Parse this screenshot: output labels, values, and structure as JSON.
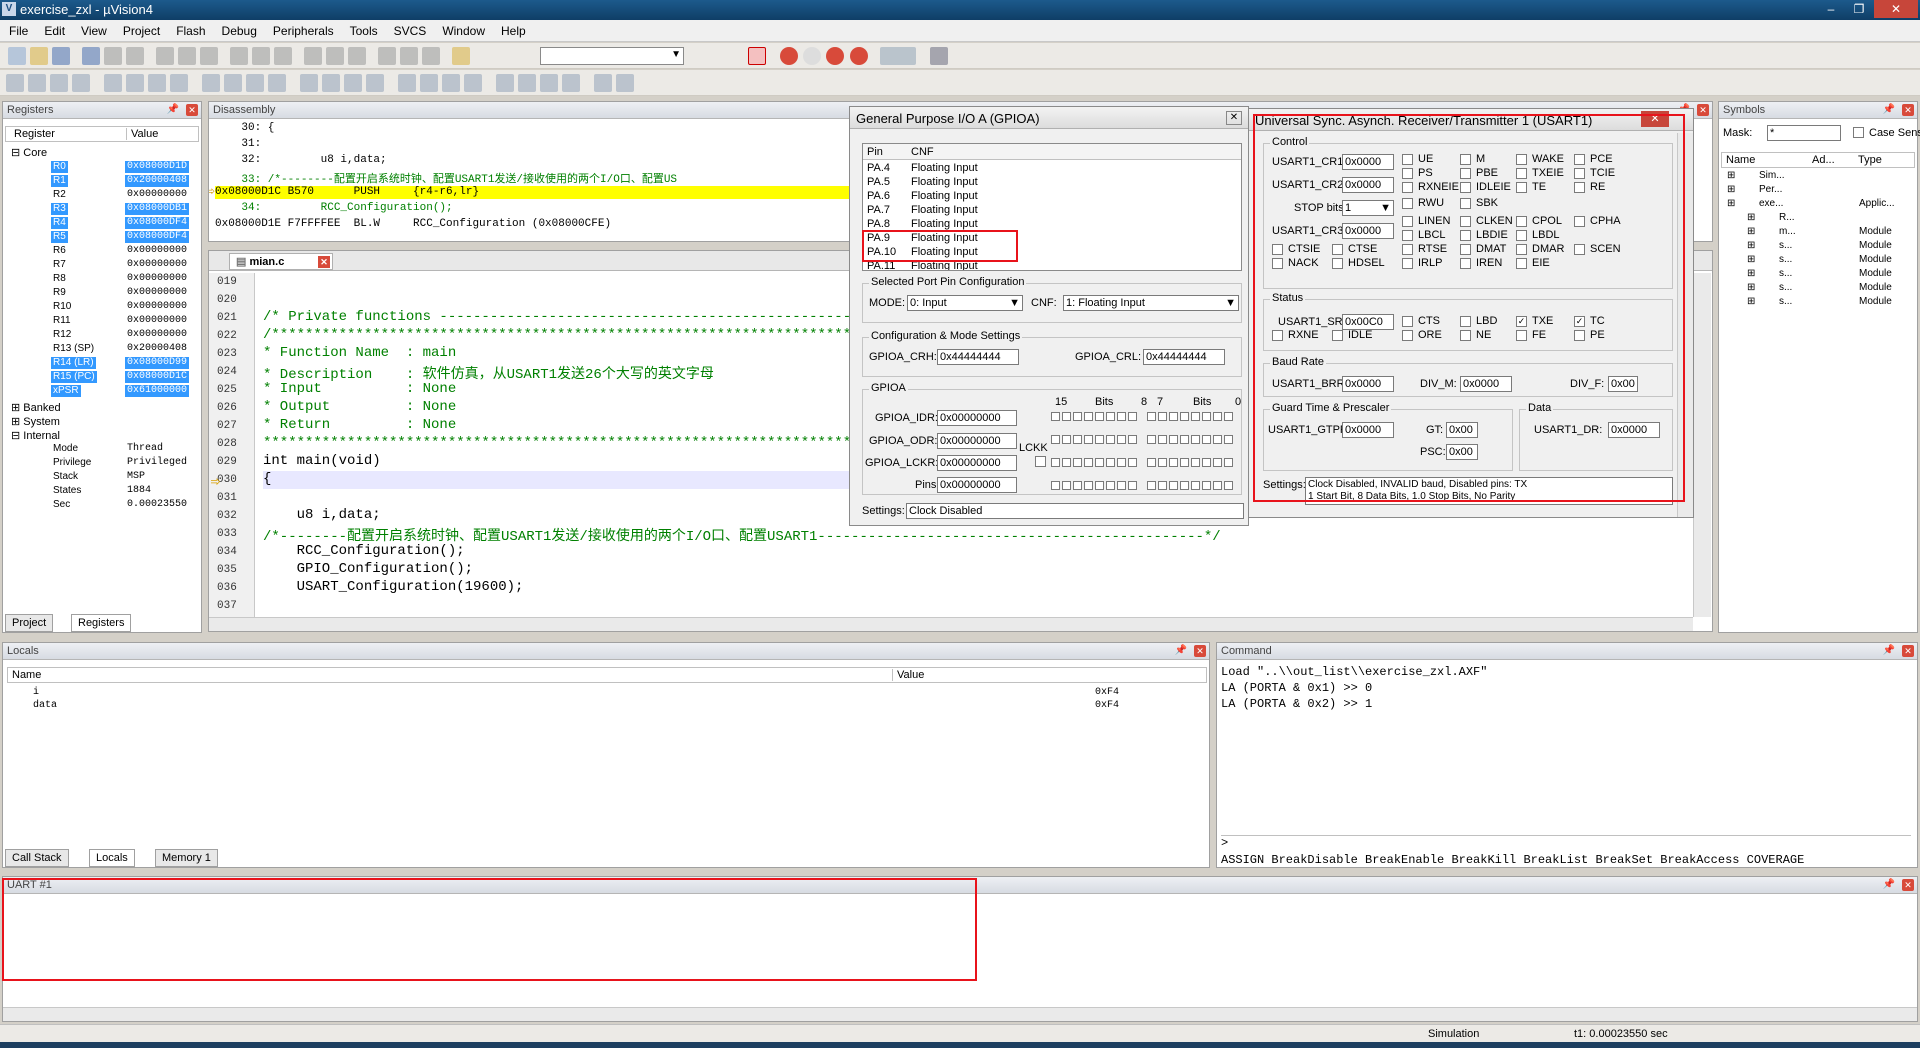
{
  "window": {
    "title": "exercise_zxl - µVision4"
  },
  "menu": [
    "File",
    "Edit",
    "View",
    "Project",
    "Flash",
    "Debug",
    "Peripherals",
    "Tools",
    "SVCS",
    "Window",
    "Help"
  ],
  "registers": {
    "title": "Registers",
    "col_register": "Register",
    "col_value": "Value",
    "core": "Core",
    "rows": [
      {
        "name": "R0",
        "value": "0x08000D1D",
        "sel": true
      },
      {
        "name": "R1",
        "value": "0x20000408",
        "sel": true
      },
      {
        "name": "R2",
        "value": "0x00000000",
        "sel": false
      },
      {
        "name": "R3",
        "value": "0x08000DB1",
        "sel": true
      },
      {
        "name": "R4",
        "value": "0x08000DF4",
        "sel": true
      },
      {
        "name": "R5",
        "value": "0x08000DF4",
        "sel": true
      },
      {
        "name": "R6",
        "value": "0x00000000",
        "sel": false
      },
      {
        "name": "R7",
        "value": "0x00000000",
        "sel": false
      },
      {
        "name": "R8",
        "value": "0x00000000",
        "sel": false
      },
      {
        "name": "R9",
        "value": "0x00000000",
        "sel": false
      },
      {
        "name": "R10",
        "value": "0x00000000",
        "sel": false
      },
      {
        "name": "R11",
        "value": "0x00000000",
        "sel": false
      },
      {
        "name": "R12",
        "value": "0x00000000",
        "sel": false
      },
      {
        "name": "R13 (SP)",
        "value": "0x20000408",
        "sel": false
      },
      {
        "name": "R14 (LR)",
        "value": "0x08000D99",
        "sel": true
      },
      {
        "name": "R15 (PC)",
        "value": "0x08000D1C",
        "sel": true
      },
      {
        "name": "xPSR",
        "value": "0x61000000",
        "sel": true
      }
    ],
    "banked": "Banked",
    "system": "System",
    "internal": "Internal",
    "internal_rows": [
      {
        "name": "Mode",
        "value": "Thread"
      },
      {
        "name": "Privilege",
        "value": "Privileged"
      },
      {
        "name": "Stack",
        "value": "MSP"
      },
      {
        "name": "States",
        "value": "1884"
      },
      {
        "name": "Sec",
        "value": "0.00023550"
      }
    ],
    "tab_project": "Project",
    "tab_registers": "Registers"
  },
  "disassembly": {
    "title": "Disassembly",
    "lines": [
      "    30: {",
      "    31:",
      "    32:         u8 i,data;",
      "    33: /*--------配置开启系统时钟、配置USART1发送/接收使用的两个I/O口、配置US",
      "0x08000D1C B570      PUSH     {r4-r6,lr}",
      "    34:         RCC_Configuration();",
      "0x08000D1E F7FFFFEE  BL.W     RCC_Configuration (0x08000CFE)"
    ]
  },
  "editor": {
    "tab": "mian.c",
    "lines": [
      {
        "n": "019",
        "t": "",
        "c": ""
      },
      {
        "n": "020",
        "t": "",
        "c": ""
      },
      {
        "n": "021",
        "t": "/* Private functions ------------------------------------------------------",
        "c": "green"
      },
      {
        "n": "022",
        "t": "/*******************************************************************************",
        "c": "green"
      },
      {
        "n": "023",
        "t": "* Function Name  : main",
        "c": "green"
      },
      {
        "n": "024",
        "t": "* Description    : 软件仿真，从USART1发送26个大写的英文字母",
        "c": "green"
      },
      {
        "n": "025",
        "t": "* Input          : None",
        "c": "green"
      },
      {
        "n": "026",
        "t": "* Output         : None",
        "c": "green"
      },
      {
        "n": "027",
        "t": "* Return         : None",
        "c": "green"
      },
      {
        "n": "028",
        "t": "*******************************************************************************",
        "c": "green"
      },
      {
        "n": "029",
        "t": "int main(void)",
        "c": ""
      },
      {
        "n": "030",
        "t": "{",
        "c": ""
      },
      {
        "n": "031",
        "t": "",
        "c": ""
      },
      {
        "n": "032",
        "t": "    u8 i,data;",
        "c": ""
      },
      {
        "n": "033",
        "t": "/*--------配置开启系统时钟、配置USART1发送/接收使用的两个I/O口、配置USART1----------------------------------------------*/",
        "c": "green"
      },
      {
        "n": "034",
        "t": "    RCC_Configuration();",
        "c": ""
      },
      {
        "n": "035",
        "t": "    GPIO_Configuration();",
        "c": ""
      },
      {
        "n": "036",
        "t": "    USART_Configuration(19600);",
        "c": ""
      },
      {
        "n": "037",
        "t": "",
        "c": ""
      }
    ]
  },
  "gpio": {
    "title": "General Purpose I/O A (GPIOA)",
    "col_pin": "Pin",
    "col_cnf": "CNF",
    "pins": [
      {
        "pin": "PA.4",
        "cnf": "Floating Input"
      },
      {
        "pin": "PA.5",
        "cnf": "Floating Input"
      },
      {
        "pin": "PA.6",
        "cnf": "Floating Input"
      },
      {
        "pin": "PA.7",
        "cnf": "Floating Input"
      },
      {
        "pin": "PA.8",
        "cnf": "Floating Input"
      },
      {
        "pin": "PA.9",
        "cnf": "Floating Input"
      },
      {
        "pin": "PA.10",
        "cnf": "Floating Input"
      },
      {
        "pin": "PA.11",
        "cnf": "Floating Input"
      }
    ],
    "selected_title": "Selected Port Pin Configuration",
    "mode_label": "MODE:",
    "mode_value": "0: Input",
    "cnf_label": "CNF:",
    "cnf_value": "1: Floating Input",
    "cfg_title": "Configuration & Mode Settings",
    "crh_label": "GPIOA_CRH:",
    "crh_value": "0x44444444",
    "crl_label": "GPIOA_CRL:",
    "crl_value": "0x44444444",
    "gpioa_title": "GPIOA",
    "bits15": "15",
    "bits_label": "Bits",
    "bits8": "8",
    "bits7": "7",
    "bits0": "0",
    "idr_label": "GPIOA_IDR:",
    "idr_value": "0x00000000",
    "odr_label": "GPIOA_ODR:",
    "odr_value": "0x00000000",
    "lckk": "LCKK",
    "lckr_label": "GPIOA_LCKR:",
    "lckr_value": "0x00000000",
    "pins_label": "Pins:",
    "pins_value": "0x00000000",
    "settings_label": "Settings:",
    "settings_value": "Clock Disabled"
  },
  "usart": {
    "title": "Universal Sync. Asynch. Receiver/Transmitter 1 (USART1)",
    "control": "Control",
    "cr1_label": "USART1_CR1:",
    "cr1_value": "0x0000",
    "cr2_label": "USART1_CR2:",
    "cr2_value": "0x0000",
    "stop_label": "STOP bits:",
    "stop_value": "1",
    "cr3_label": "USART1_CR3:",
    "cr3_value": "0x0000",
    "ctrl_checks": [
      "UE",
      "M",
      "WAKE",
      "PCE",
      "PS",
      "PBE",
      "TXEIE",
      "TCIE",
      "RXNEIE",
      "IDLEIE",
      "TE",
      "RE",
      "RWU",
      "SBK",
      "LINEN",
      "CLKEN",
      "CPOL",
      "CPHA",
      "LBCL",
      "LBDIE",
      "LBDL",
      "CTSIE",
      "CTSE",
      "RTSE",
      "DMAT",
      "DMAR",
      "SCEN",
      "NACK",
      "HDSEL",
      "IRLP",
      "IREN",
      "EIE"
    ],
    "status": "Status",
    "sr_label": "USART1_SR:",
    "sr_value": "0x00C0",
    "status_checks": [
      "CTS",
      "LBD",
      "TXE",
      "TC",
      "RXNE",
      "IDLE",
      "ORE",
      "NE",
      "FE",
      "PE"
    ],
    "baud_title": "Baud Rate",
    "brr_label": "USART1_BRR:",
    "brr_value": "0x0000",
    "divm_label": "DIV_M:",
    "divm_value": "0x0000",
    "divf_label": "DIV_F:",
    "divf_value": "0x00",
    "guard_title": "Guard Time & Prescaler",
    "gtpr_label": "USART1_GTPR:",
    "gtpr_value": "0x0000",
    "gt_label": "GT:",
    "gt_value": "0x00",
    "psc_label": "PSC:",
    "psc_value": "0x00",
    "data_title": "Data",
    "dr_label": "USART1_DR:",
    "dr_value": "0x0000",
    "settings_label": "Settings:",
    "settings_line1": "Clock Disabled, INVALID baud, Disabled pins: TX",
    "settings_line2": "1 Start Bit, 8 Data Bits, 1.0 Stop Bits, No Parity"
  },
  "symbols": {
    "title": "Symbols",
    "mask_label": "Mask:",
    "mask_value": "*",
    "case_label": "Case Sens",
    "col_name": "Name",
    "col_addr": "Ad...",
    "col_type": "Type",
    "rows": [
      {
        "name": "Sim...",
        "type": ""
      },
      {
        "name": "Per...",
        "type": ""
      },
      {
        "name": "exe...",
        "type": "Applic..."
      },
      {
        "name": "R...",
        "type": ""
      },
      {
        "name": "m...",
        "type": "Module"
      },
      {
        "name": "s...",
        "type": "Module"
      },
      {
        "name": "s...",
        "type": "Module"
      },
      {
        "name": "s...",
        "type": "Module"
      },
      {
        "name": "s...",
        "type": "Module"
      },
      {
        "name": "s...",
        "type": "Module"
      }
    ]
  },
  "locals": {
    "title": "Locals",
    "col_name": "Name",
    "col_value": "Value",
    "rows": [
      {
        "name": "i",
        "value": "0xF4"
      },
      {
        "name": "data",
        "value": "0xF4"
      }
    ],
    "tabs": [
      "Call Stack",
      "Locals",
      "Memory 1"
    ]
  },
  "command": {
    "title": "Command",
    "lines": [
      "Load \"..\\\\out_list\\\\exercise_zxl.AXF\"",
      "LA (PORTA & 0x1) >> 0",
      "LA (PORTA & 0x2) >> 1"
    ],
    "prompt": ">",
    "hints": "ASSIGN BreakDisable BreakEnable BreakKill BreakList BreakSet BreakAccess COVERAGE"
  },
  "uart": {
    "title": "UART #1"
  },
  "status": {
    "mode": "Simulation",
    "time": "t1: 0.00023550 sec"
  },
  "colors": {
    "selection": "#3399ff",
    "highlight_line": "#ffff00",
    "annotation": "#e8131b",
    "comment": "#008000"
  }
}
